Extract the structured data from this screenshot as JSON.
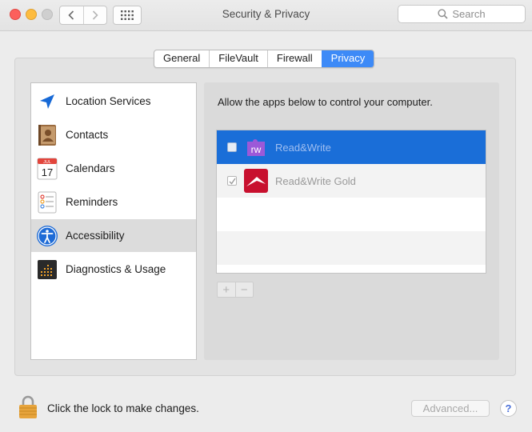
{
  "window": {
    "title": "Security & Privacy"
  },
  "toolbar": {
    "search_placeholder": "Search"
  },
  "tabs": [
    {
      "label": "General",
      "active": false
    },
    {
      "label": "FileVault",
      "active": false
    },
    {
      "label": "Firewall",
      "active": false
    },
    {
      "label": "Privacy",
      "active": true
    }
  ],
  "sidebar": {
    "items": [
      {
        "label": "Location Services",
        "icon": "location-arrow-icon",
        "selected": false
      },
      {
        "label": "Contacts",
        "icon": "contacts-book-icon",
        "selected": false
      },
      {
        "label": "Calendars",
        "icon": "calendar-icon",
        "selected": false,
        "icon_text_month": "JUL",
        "icon_text_day": "17"
      },
      {
        "label": "Reminders",
        "icon": "reminders-list-icon",
        "selected": false
      },
      {
        "label": "Accessibility",
        "icon": "accessibility-icon",
        "selected": true
      },
      {
        "label": "Diagnostics & Usage",
        "icon": "diagnostics-icon",
        "selected": false
      }
    ]
  },
  "main": {
    "prompt": "Allow the apps below to control your computer.",
    "apps": [
      {
        "name": "Read&Write",
        "checked": false,
        "selected": true,
        "icon": "readwrite-puzzle-icon",
        "icon_text": "rw"
      },
      {
        "name": "Read&Write Gold",
        "checked": true,
        "selected": false,
        "icon": "readwrite-gold-icon"
      }
    ],
    "add_label": "+",
    "remove_label": "−"
  },
  "footer": {
    "lock_text": "Click the lock to make changes.",
    "advanced_label": "Advanced...",
    "help_label": "?"
  },
  "colors": {
    "accent": "#3d8af7",
    "selection": "#1a6ed8",
    "close": "#fc605c",
    "minimize": "#fdbc40"
  }
}
